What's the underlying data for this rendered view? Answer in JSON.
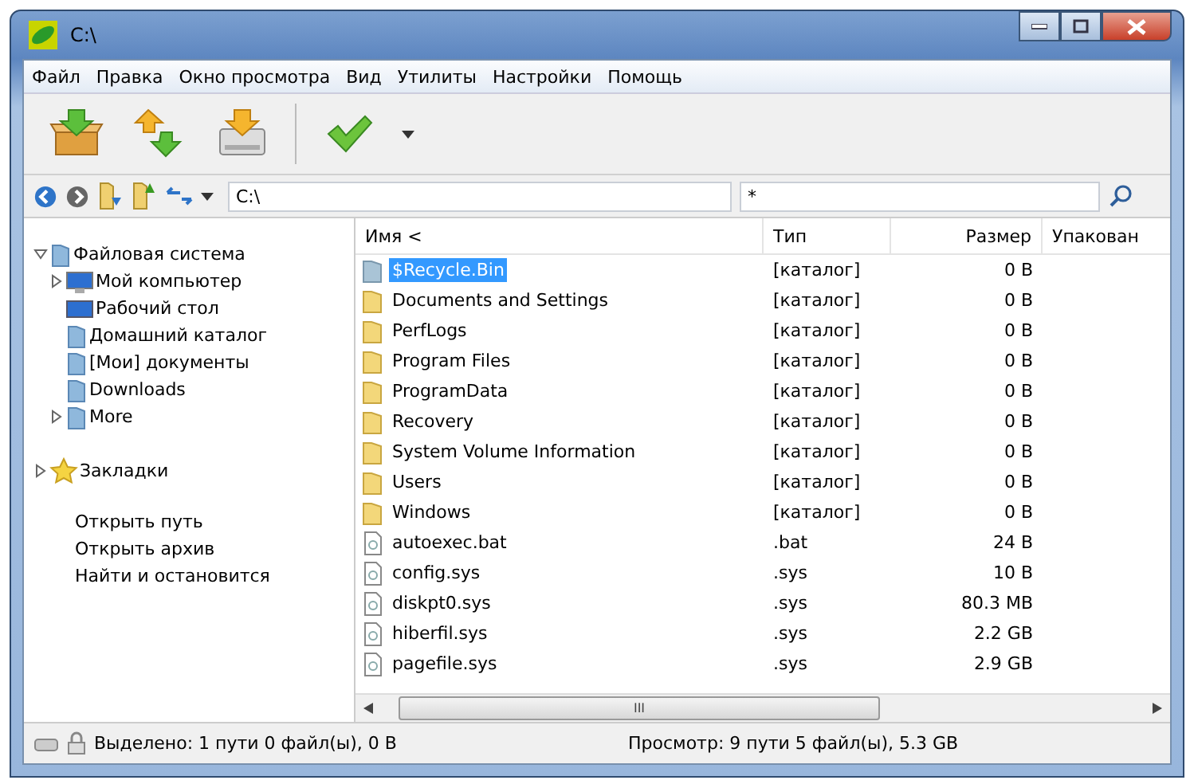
{
  "window": {
    "title": "C:\\"
  },
  "menu": [
    "Файл",
    "Правка",
    "Окно просмотра",
    "Вид",
    "Утилиты",
    "Настройки",
    "Помощь"
  ],
  "address": {
    "value": "C:\\"
  },
  "filter": {
    "value": "*"
  },
  "tree": [
    {
      "label": "Файловая система",
      "kind": "folder",
      "expanded": true,
      "children": [
        {
          "label": "Мой компьютер",
          "kind": "computer",
          "expanded": false
        },
        {
          "label": "Рабочий стол",
          "kind": "desktop"
        },
        {
          "label": "Домашний каталог",
          "kind": "folder"
        },
        {
          "label": "[Мои] документы",
          "kind": "folder"
        },
        {
          "label": "Downloads",
          "kind": "folder"
        },
        {
          "label": "More",
          "kind": "folder",
          "expanded": false
        }
      ]
    },
    {
      "label": "Закладки",
      "kind": "star",
      "expanded": false
    }
  ],
  "links": [
    "Открыть путь",
    "Открыть архив",
    "Найти и остановится"
  ],
  "table": {
    "columns": [
      "Имя <",
      "Тип",
      "Размер",
      "Упакован"
    ],
    "rows": [
      {
        "name": "$Recycle.Bin",
        "type": "[каталог]",
        "size": "0 B",
        "kind": "hidden-folder",
        "selected": true
      },
      {
        "name": "Documents and Settings",
        "type": "[каталог]",
        "size": "0 B",
        "kind": "folder",
        "selected": false
      },
      {
        "name": "PerfLogs",
        "type": "[каталог]",
        "size": "0 B",
        "kind": "folder",
        "selected": false
      },
      {
        "name": "Program Files",
        "type": "[каталог]",
        "size": "0 B",
        "kind": "folder",
        "selected": false
      },
      {
        "name": "ProgramData",
        "type": "[каталог]",
        "size": "0 B",
        "kind": "folder",
        "selected": false
      },
      {
        "name": "Recovery",
        "type": "[каталог]",
        "size": "0 B",
        "kind": "folder",
        "selected": false
      },
      {
        "name": "System Volume Information",
        "type": "[каталог]",
        "size": "0 B",
        "kind": "folder",
        "selected": false
      },
      {
        "name": "Users",
        "type": "[каталог]",
        "size": "0 B",
        "kind": "folder",
        "selected": false
      },
      {
        "name": "Windows",
        "type": "[каталог]",
        "size": "0 B",
        "kind": "folder",
        "selected": false
      },
      {
        "name": "autoexec.bat",
        "type": ".bat",
        "size": "24 B",
        "kind": "file",
        "selected": false
      },
      {
        "name": "config.sys",
        "type": ".sys",
        "size": "10 B",
        "kind": "file",
        "selected": false
      },
      {
        "name": "diskpt0.sys",
        "type": ".sys",
        "size": "80.3 MB",
        "kind": "file",
        "selected": false
      },
      {
        "name": "hiberfil.sys",
        "type": ".sys",
        "size": "2.2 GB",
        "kind": "file",
        "selected": false
      },
      {
        "name": "pagefile.sys",
        "type": ".sys",
        "size": "2.9 GB",
        "kind": "file",
        "selected": false
      }
    ]
  },
  "scrollbar_grip": "III",
  "status_bar": {
    "selected": "Выделено: 1 пути 0 файл(ы), 0 B",
    "view": "Просмотр: 9 пути 5 файл(ы), 5.3 GB"
  }
}
